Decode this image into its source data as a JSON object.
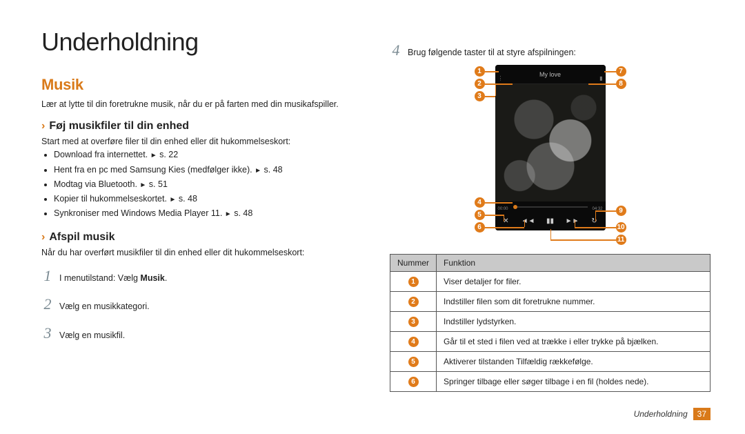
{
  "page_title": "Underholdning",
  "section": {
    "title": "Musik",
    "intro": "Lær at lytte til din foretrukne musik, når du er på farten med din musikafspiller."
  },
  "sub_add": {
    "title": "Føj musikfiler til din enhed",
    "lead": "Start med at overføre filer til din enhed eller dit hukommelseskort:",
    "bullets": [
      {
        "text": "Download fra internettet.",
        "ref": "s. 22"
      },
      {
        "text": "Hent fra en pc med Samsung Kies (medfølger ikke).",
        "ref": "s. 48"
      },
      {
        "text": "Modtag via Bluetooth.",
        "ref": "s. 51"
      },
      {
        "text": "Kopier til hukommelseskortet.",
        "ref": "s. 48"
      },
      {
        "text": "Synkroniser med Windows Media Player 11.",
        "ref": "s. 48"
      }
    ]
  },
  "sub_play": {
    "title": "Afspil musik",
    "lead": "Når du har overført musikfiler til din enhed eller dit hukommelseskort:",
    "steps": [
      {
        "n": "1",
        "pre": "I menutilstand: Vælg ",
        "bold": "Musik",
        "post": "."
      },
      {
        "n": "2",
        "pre": "Vælg en musikkategori.",
        "bold": "",
        "post": ""
      },
      {
        "n": "3",
        "pre": "Vælg en musikfil.",
        "bold": "",
        "post": ""
      }
    ]
  },
  "right": {
    "step4": {
      "n": "4",
      "text": "Brug følgende taster til at styre afspilningen:"
    },
    "player_title": "My love",
    "time_left": "00:00",
    "time_right": "04:32",
    "callouts_left": [
      "1",
      "2",
      "3",
      "4",
      "5",
      "6"
    ],
    "callouts_right": [
      "7",
      "8",
      "9",
      "10",
      "11"
    ]
  },
  "table": {
    "headers": {
      "num": "Nummer",
      "func": "Funktion"
    },
    "rows": [
      {
        "idx": "1",
        "text": "Viser detaljer for filer."
      },
      {
        "idx": "2",
        "text": "Indstiller filen som dit foretrukne nummer."
      },
      {
        "idx": "3",
        "text": "Indstiller lydstyrken."
      },
      {
        "idx": "4",
        "text": "Går til et sted i filen ved at trække i eller trykke på bjælken."
      },
      {
        "idx": "5",
        "text": "Aktiverer tilstanden Tilfældig rækkefølge."
      },
      {
        "idx": "6",
        "text": "Springer tilbage eller søger tilbage i en fil (holdes nede)."
      }
    ]
  },
  "footer": {
    "section": "Underholdning",
    "page": "37"
  },
  "glyphs": {
    "tri": "►",
    "chev": "›"
  }
}
